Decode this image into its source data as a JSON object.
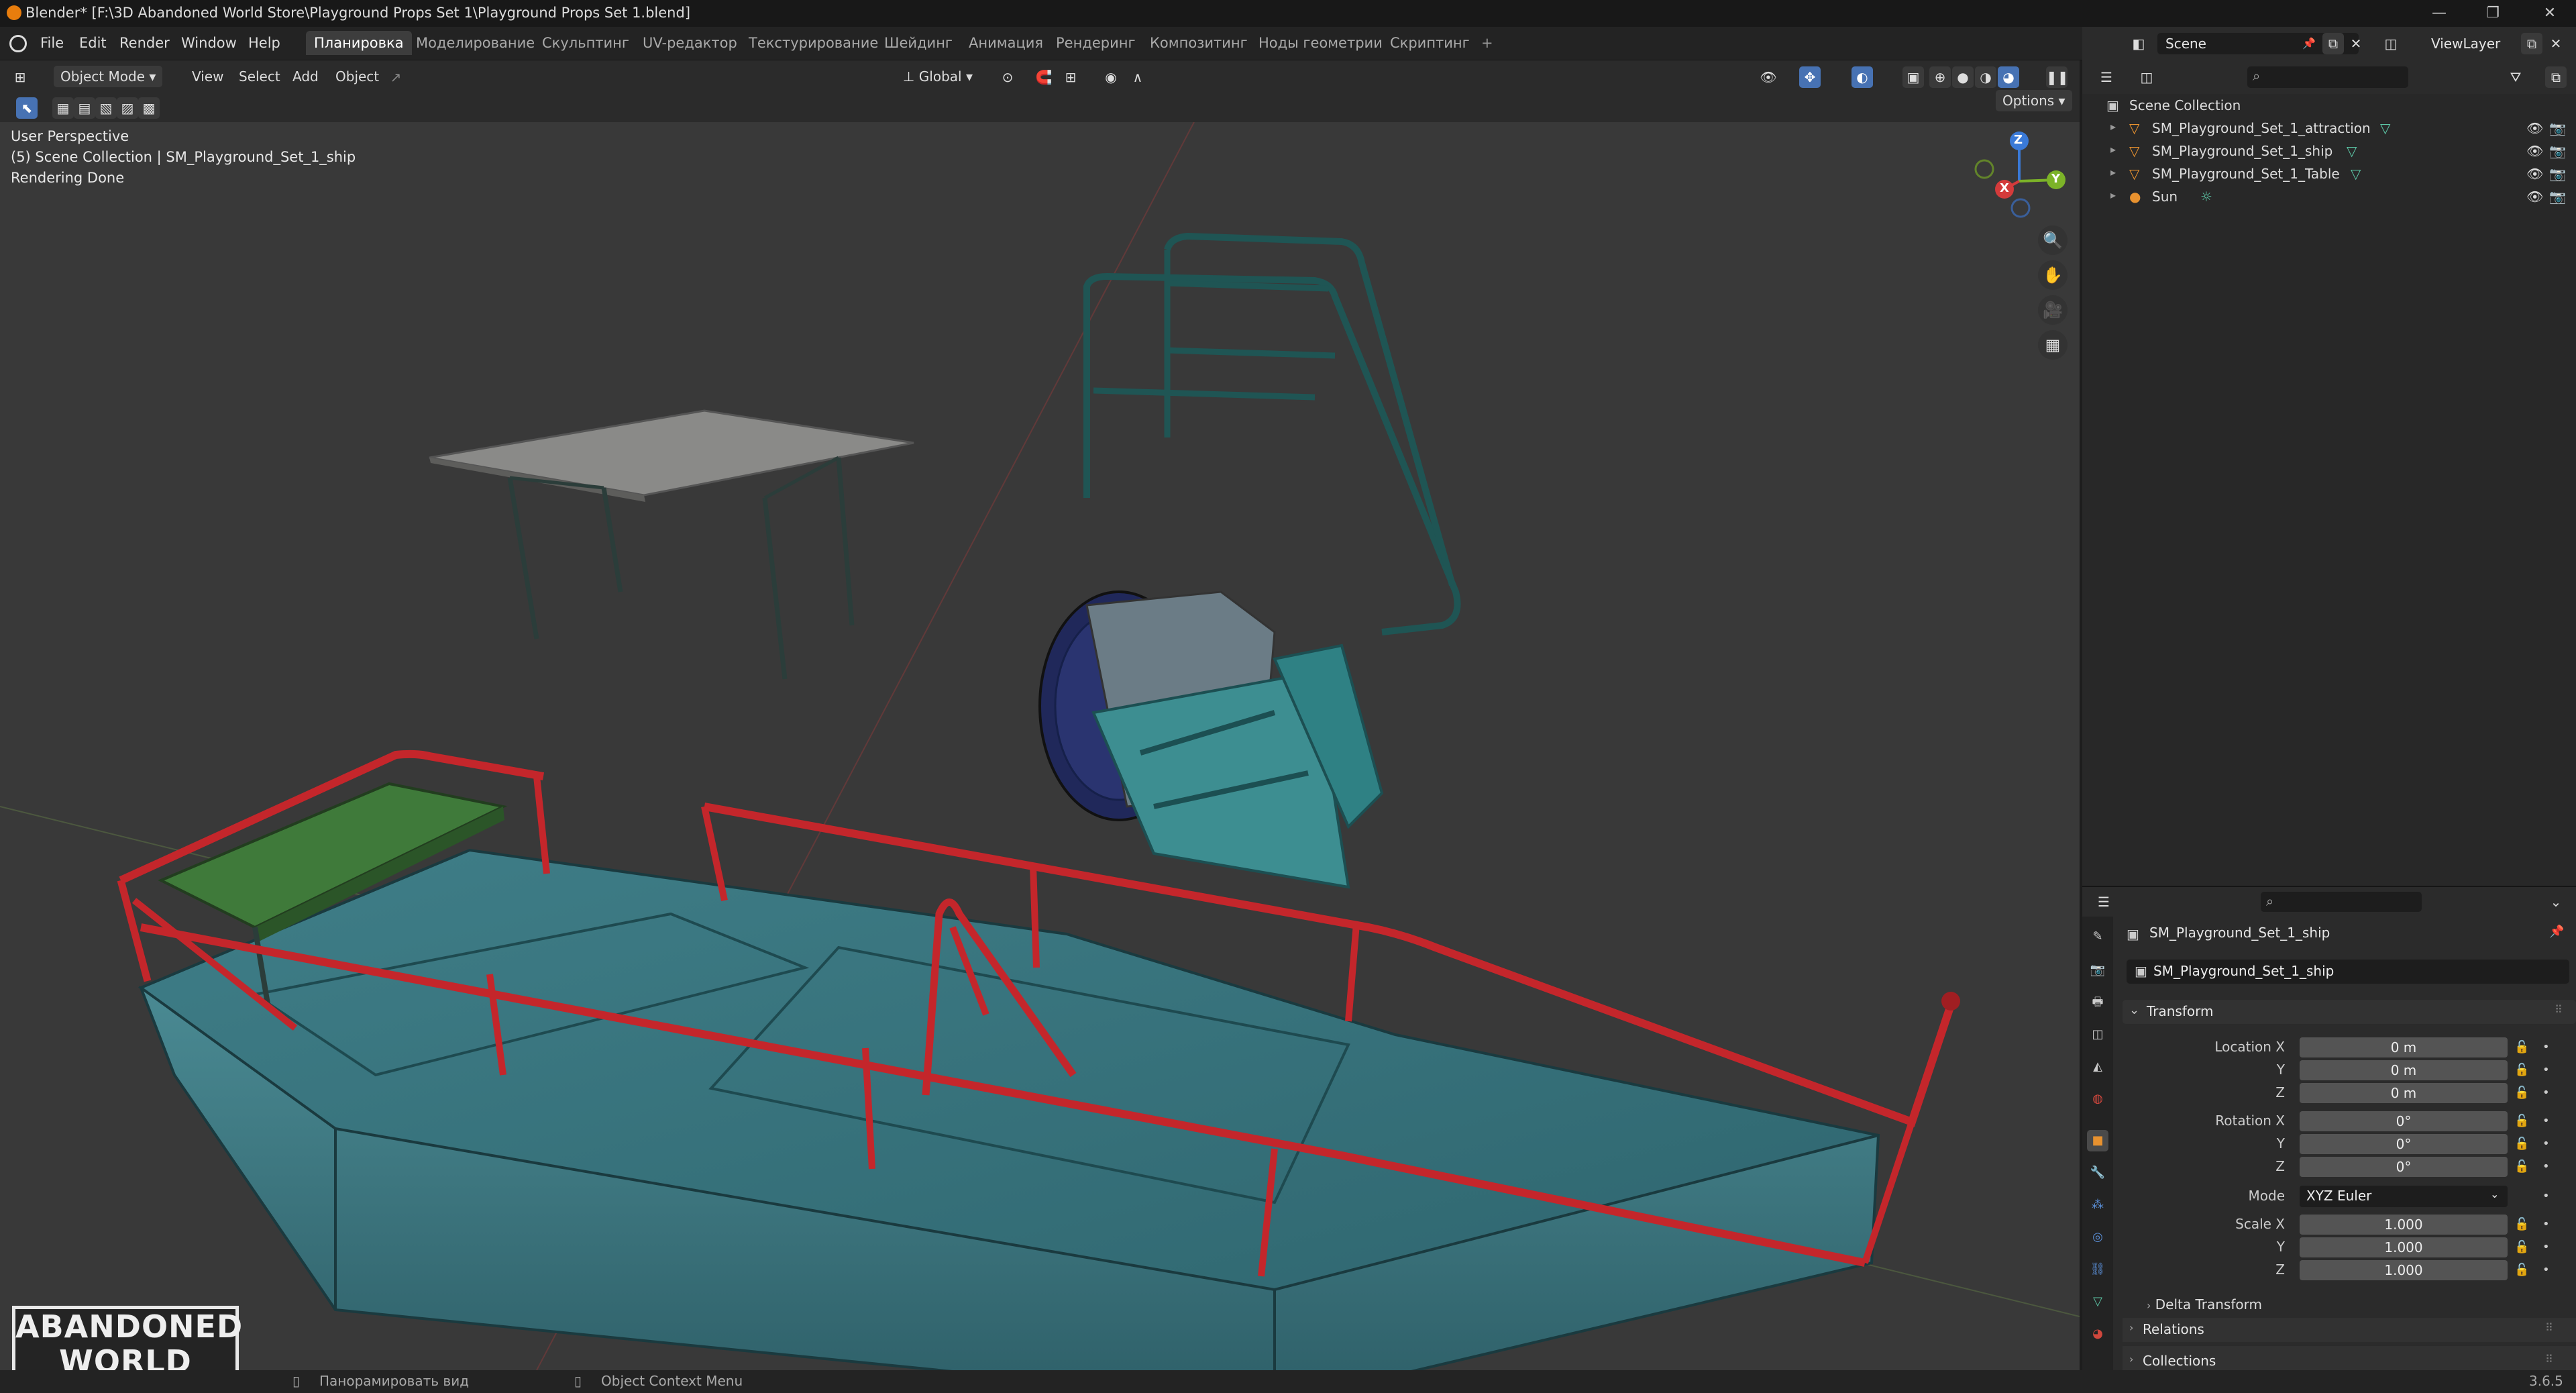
{
  "window": {
    "title": "Blender* [F:\\3D Abandoned World Store\\Playground Props Set 1\\Playground Props Set 1.blend]"
  },
  "menubar": {
    "menus": [
      "File",
      "Edit",
      "Render",
      "Window",
      "Help"
    ],
    "workspaces": [
      "Планировка",
      "Моделирование",
      "Скульптинг",
      "UV-редактор",
      "Текстурирование",
      "Шейдинг",
      "Анимация",
      "Рендеринг",
      "Композитинг",
      "Ноды геометрии",
      "Скриптинг"
    ],
    "add_tab": "+",
    "scene_label": "Scene",
    "view_layer_label": "ViewLayer"
  },
  "viewport_header": {
    "mode": "Object Mode",
    "menus": [
      "View",
      "Select",
      "Add",
      "Object"
    ],
    "orientation": "Global",
    "options": "Options"
  },
  "viewport_overlay": {
    "perspective": "User Perspective",
    "collection_info": "(5) Scene Collection | SM_Playground_Set_1_ship",
    "render_status": "Rendering Done"
  },
  "gizmo": {
    "x": "X",
    "y": "Y",
    "z": "Z"
  },
  "outliner": {
    "root": "Scene Collection",
    "items": [
      {
        "label": "SM_Playground_Set_1_attraction"
      },
      {
        "label": "SM_Playground_Set_1_ship"
      },
      {
        "label": "SM_Playground_Set_1_Table"
      },
      {
        "label": "Sun"
      }
    ]
  },
  "properties": {
    "object_name": "SM_Playground_Set_1_ship",
    "data_name": "SM_Playground_Set_1_ship",
    "transform_header": "Transform",
    "location_label": "Location X",
    "rotation_label": "Rotation X",
    "scale_label": "Scale X",
    "y_label": "Y",
    "z_label": "Z",
    "location": [
      "0 m",
      "0 m",
      "0 m"
    ],
    "rotation": [
      "0°",
      "0°",
      "0°"
    ],
    "mode_label": "Mode",
    "mode_value": "XYZ Euler",
    "scale": [
      "1.000",
      "1.000",
      "1.000"
    ],
    "delta_transform": "Delta Transform",
    "relations": "Relations",
    "collections": "Collections"
  },
  "statusbar": {
    "hint_pan": "Панорамировать вид",
    "hint_context": "Object Context Menu",
    "version": "3.6.5"
  },
  "watermark": {
    "line1": "ABANDONED",
    "line2": "WORLD"
  },
  "colors": {
    "accent": "#4772b3",
    "rail_red": "#c4262b",
    "hull_teal": "#3e7a84",
    "bench_green": "#3f7a3a"
  }
}
